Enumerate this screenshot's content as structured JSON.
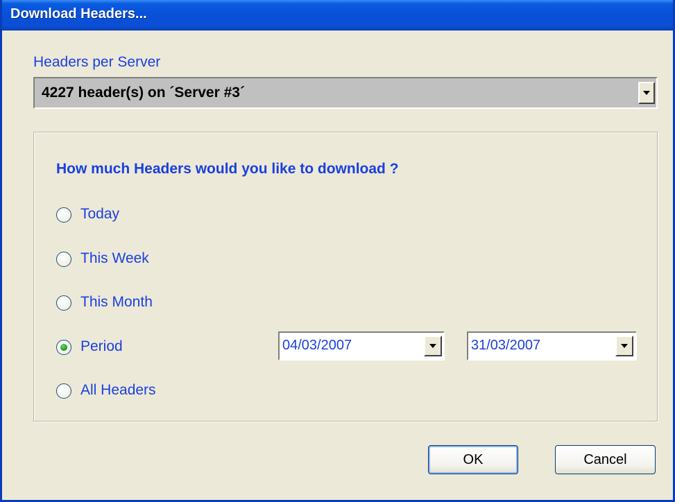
{
  "window": {
    "title": "Download Headers..."
  },
  "server": {
    "label": "Headers per Server",
    "selected": "4227 header(s) on ´Server #3´"
  },
  "group": {
    "question": "How much Headers would you like to download ?",
    "options": [
      {
        "label": "Today",
        "checked": false
      },
      {
        "label": "This Week",
        "checked": false
      },
      {
        "label": "This Month",
        "checked": false
      },
      {
        "label": "Period",
        "checked": true
      },
      {
        "label": "All Headers",
        "checked": false
      }
    ],
    "period_from": "04/03/2007",
    "period_to": "31/03/2007"
  },
  "buttons": {
    "ok": "OK",
    "cancel": "Cancel"
  },
  "colors": {
    "titlebar": "#0A5BE0",
    "accent_text": "#1A3FE0",
    "face": "#ECE9D8"
  }
}
